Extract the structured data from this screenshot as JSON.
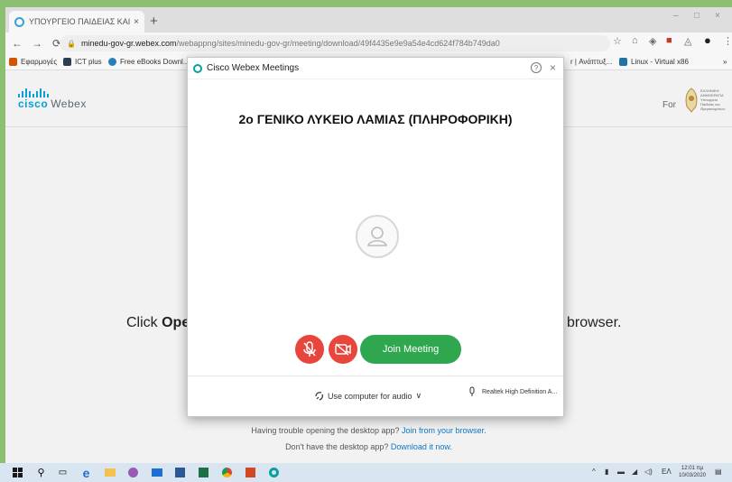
{
  "browser": {
    "tab_title": "ΥΠΟΥΡΓΕΙΟ ΠΑΙΔΕΙΑΣ ΚΑΙ ΘΡΗΣ",
    "tab_close": "×",
    "new_tab": "+",
    "window_controls": [
      "–",
      "□",
      "×"
    ],
    "url_domain": "minedu-gov-gr.webex.com",
    "url_path": "/webappng/sites/minedu-gov-gr/meeting/download/49f4435e9e9a54e4cd624f784b749da0",
    "bookmarks": [
      "Εφαρμογές",
      "ICT plus",
      "Free eBooks Downl...",
      "r | Ανάπτυξ...",
      "Linux - Virtual x86"
    ],
    "bookmarks_overflow": "»"
  },
  "page": {
    "brand_word": "cisco",
    "brand_product": "Webex",
    "for_label": "For",
    "seal_text": "ΕΛΛΗΝΙΚΗ ΔΗΜΟΚΡΑΤΙΑ Υπουργείο Παιδείας και Θρησκευμάτων",
    "click_prefix": "Click ",
    "click_bold": "Ope",
    "click_suffix": "browser.",
    "trouble_text": "Having trouble opening the desktop app? ",
    "trouble_link": "Join from your browser",
    "trouble_end": ".",
    "no_app_text": "Don't have the desktop app? ",
    "no_app_link": "Download it now",
    "no_app_end": "."
  },
  "dialog": {
    "title": "Cisco Webex Meetings",
    "help": "?",
    "close": "×",
    "meeting_title": "2ο ΓΕΝΙΚΟ ΛΥΚΕΙΟ ΛΑΜΙΑΣ (ΠΛΗΡΟΦΟΡΙΚΗ)",
    "join_label": "Join Meeting",
    "audio_label": "Use computer for audio",
    "audio_caret": "∨",
    "speaker_label": "Realtek High Definition A..."
  },
  "taskbar": {
    "tray_lang": "ΕΛ",
    "clock_time": "12:01 πμ",
    "clock_date": "10/03/2020"
  },
  "colors": {
    "accent_green": "#2fa74f",
    "danger_red": "#e8453c",
    "cisco_blue": "#049fd9",
    "link_blue": "#0a78c8"
  }
}
